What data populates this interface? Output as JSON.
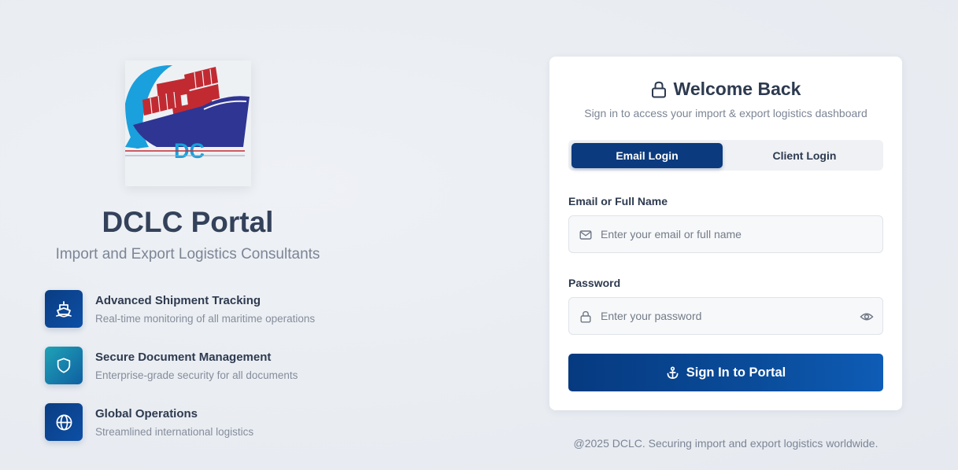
{
  "brand": {
    "title": "DCLC Portal",
    "subtitle": "Import and Export Logistics Consultants",
    "logo_text": "DC"
  },
  "features": [
    {
      "icon": "ship-icon",
      "title": "Advanced Shipment Tracking",
      "description": "Real-time monitoring of all maritime operations"
    },
    {
      "icon": "shield-icon",
      "title": "Secure Document Management",
      "description": "Enterprise-grade security for all documents"
    },
    {
      "icon": "globe-icon",
      "title": "Global Operations",
      "description": "Streamlined international logistics"
    }
  ],
  "login": {
    "title": "Welcome Back",
    "subtitle": "Sign in to access your import & export logistics dashboard",
    "tabs": [
      "Email Login",
      "Client Login"
    ],
    "active_tab": "Email Login",
    "email_label": "Email or Full Name",
    "email_placeholder": "Enter your email or full name",
    "email_value": "",
    "password_label": "Password",
    "password_placeholder": "Enter your password",
    "password_value": "",
    "submit_label": "Sign In to Portal"
  },
  "footer": "@2025 DCLC. Securing import and export logistics worldwide.",
  "colors": {
    "primary": "#0b3a7e",
    "accent_teal": "#1fa3b6",
    "text": "#2d3a4f",
    "muted": "#7c8595"
  }
}
